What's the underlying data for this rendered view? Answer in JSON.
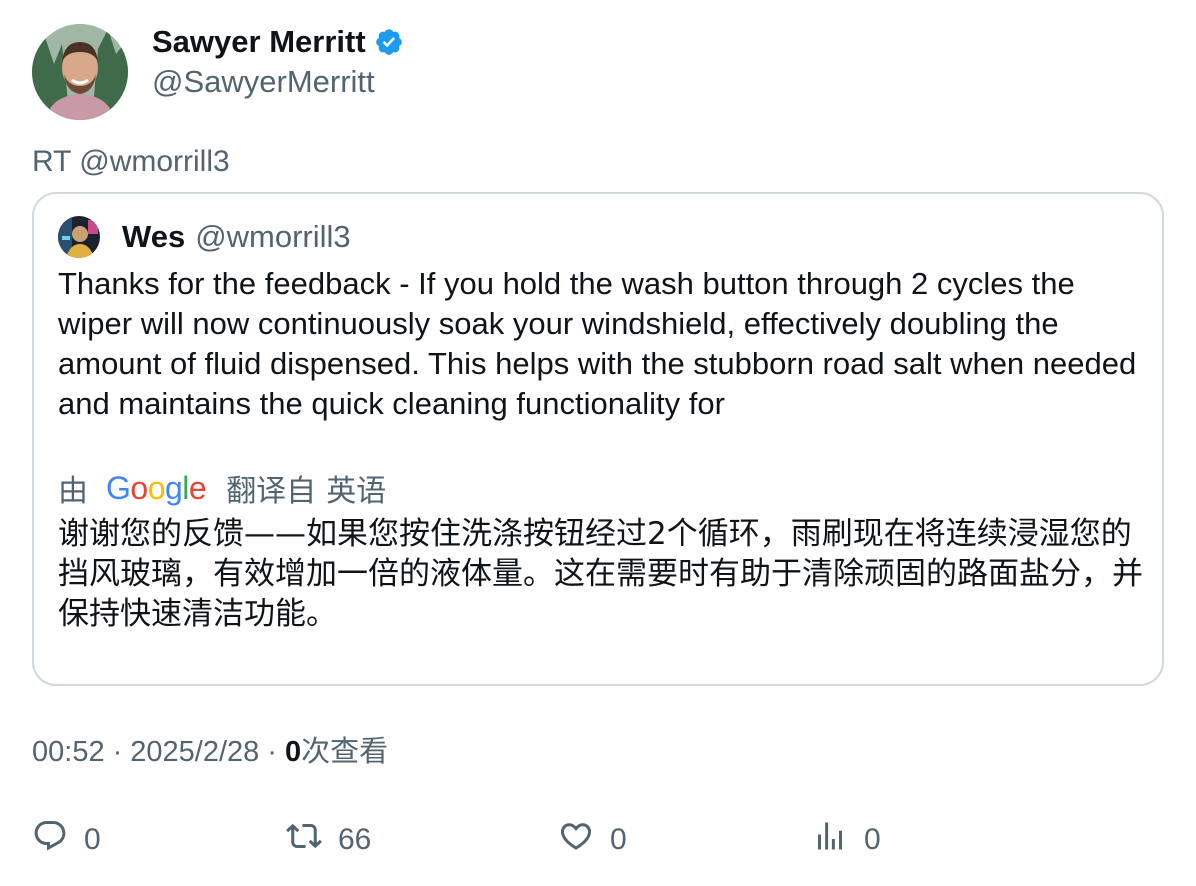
{
  "author": {
    "display_name": "Sawyer Merritt",
    "handle": "@SawyerMerritt",
    "verified_icon": "verified-badge-icon",
    "accent_color": "#1d9bf0"
  },
  "retweet_line": "RT @wmorrill3",
  "quoted": {
    "display_name": "Wes",
    "handle": "@wmorrill3",
    "text": "Thanks for the feedback - If you hold the wash button through 2 cycles the wiper will now continuously soak your windshield, effectively doubling the amount of fluid dispensed. This helps with the stubborn road salt when needed and maintains the quick cleaning functionality for"
  },
  "translation": {
    "by_label": "由",
    "provider": "Google",
    "from_label": "翻译自",
    "language": "英语",
    "text": "谢谢您的反馈——如果您按住洗涤按钮经过2个循环，雨刷现在将连续浸湿您的挡风玻璃，有效增加一倍的液体量。这在需要时有助于清除顽固的路面盐分，并保持快速清洁功能。"
  },
  "meta": {
    "time": "00:52",
    "separator": "·",
    "date": "2025/2/28",
    "views_count": "0",
    "views_label": "次查看"
  },
  "actions": {
    "replies": "0",
    "retweets": "66",
    "likes": "0",
    "views": "0"
  }
}
